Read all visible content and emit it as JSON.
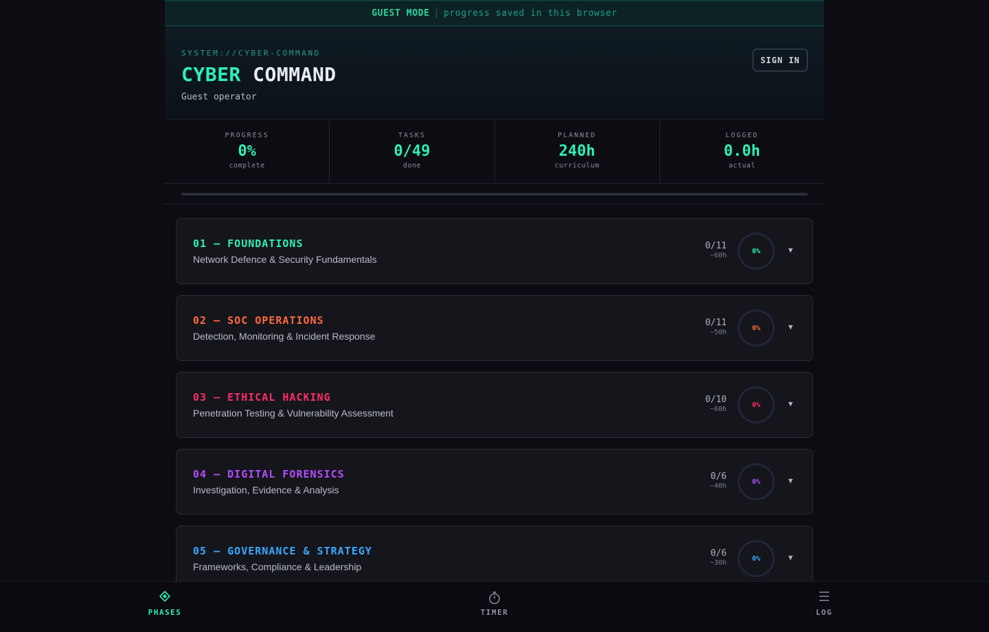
{
  "banner": {
    "mode": "GUEST MODE",
    "separator": "|",
    "message": "progress saved in this browser"
  },
  "header": {
    "system_label": "SYSTEM://CYBER-COMMAND",
    "title_part1": "CYBER",
    "title_part2": "COMMAND",
    "operator": "Guest operator",
    "sign_in_label": "SIGN IN"
  },
  "stats": [
    {
      "label": "PROGRESS",
      "value": "0%",
      "sub": "complete"
    },
    {
      "label": "TASKS",
      "value": "0/49",
      "sub": "done"
    },
    {
      "label": "PLANNED",
      "value": "240h",
      "sub": "curriculum"
    },
    {
      "label": "LOGGED",
      "value": "0.0h",
      "sub": "actual"
    }
  ],
  "overall_progress": 0,
  "phases": [
    {
      "title": "01 — FOUNDATIONS",
      "subtitle": "Network Defence & Security Fundamentals",
      "done": "0/11",
      "hours": "~60h",
      "percent": "0%",
      "color": "#2ef0b4"
    },
    {
      "title": "02 — SOC OPERATIONS",
      "subtitle": "Detection, Monitoring & Incident Response",
      "done": "0/11",
      "hours": "~50h",
      "percent": "0%",
      "color": "#ff6a3d"
    },
    {
      "title": "03 — ETHICAL HACKING",
      "subtitle": "Penetration Testing & Vulnerability Assessment",
      "done": "0/10",
      "hours": "~60h",
      "percent": "0%",
      "color": "#ff2d6a"
    },
    {
      "title": "04 — DIGITAL FORENSICS",
      "subtitle": "Investigation, Evidence & Analysis",
      "done": "0/6",
      "hours": "~40h",
      "percent": "0%",
      "color": "#b44dff"
    },
    {
      "title": "05 — GOVERNANCE & STRATEGY",
      "subtitle": "Frameworks, Compliance & Leadership",
      "done": "0/6",
      "hours": "~30h",
      "percent": "0%",
      "color": "#3aa8ff"
    }
  ],
  "nav": [
    {
      "label": "PHASES",
      "icon": "diamond-icon",
      "active": true
    },
    {
      "label": "TIMER",
      "icon": "stopwatch-icon",
      "active": false
    },
    {
      "label": "LOG",
      "icon": "menu-lines-icon",
      "active": false
    }
  ],
  "colors": {
    "accent": "#2ef0b4",
    "nav_inactive": "#8a909c"
  }
}
